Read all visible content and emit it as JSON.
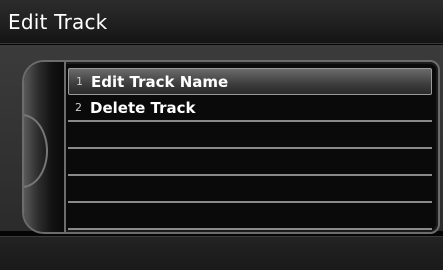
{
  "header": {
    "title": "Edit Track"
  },
  "menu": {
    "items": [
      {
        "number": "1",
        "label": "Edit Track Name"
      },
      {
        "number": "2",
        "label": "Delete Track"
      },
      {
        "number": "",
        "label": ""
      },
      {
        "number": "",
        "label": ""
      },
      {
        "number": "",
        "label": ""
      },
      {
        "number": "",
        "label": ""
      }
    ]
  }
}
